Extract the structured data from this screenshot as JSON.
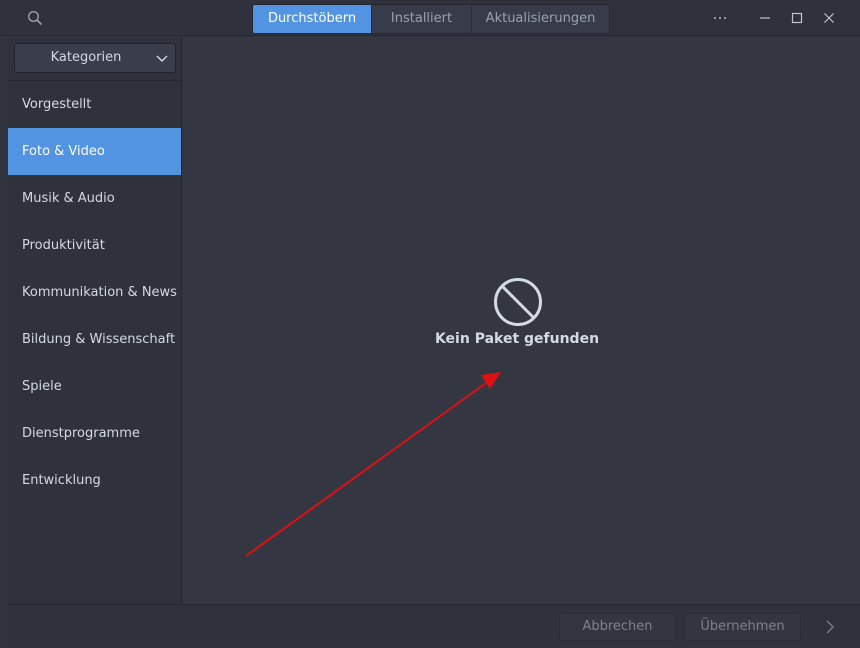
{
  "header": {
    "search_icon": "search-icon",
    "tabs": [
      {
        "label": "Durchstöbern",
        "active": true
      },
      {
        "label": "Installiert",
        "active": false
      },
      {
        "label": "Aktualisierungen",
        "active": false
      }
    ],
    "menu_icon": "more-horizontal-icon",
    "window_controls": [
      "minimize-icon",
      "maximize-icon",
      "close-icon"
    ]
  },
  "sidebar": {
    "category_select": {
      "label": "Kategorien"
    },
    "items": [
      {
        "label": "Vorgestellt",
        "active": false
      },
      {
        "label": "Foto & Video",
        "active": true
      },
      {
        "label": "Musik & Audio",
        "active": false
      },
      {
        "label": "Produktivität",
        "active": false
      },
      {
        "label": "Kommunikation & News",
        "active": false
      },
      {
        "label": "Bildung & Wissenschaft",
        "active": false
      },
      {
        "label": "Spiele",
        "active": false
      },
      {
        "label": "Dienstprogramme",
        "active": false
      },
      {
        "label": "Entwicklung",
        "active": false
      }
    ]
  },
  "main": {
    "empty_state": {
      "icon": "no-entry-icon",
      "text": "Kein Paket gefunden"
    },
    "annotation": {
      "icon": "red-arrow",
      "color": "#dd1111"
    }
  },
  "footer": {
    "cancel_label": "Abbrechen",
    "apply_label": "Übernehmen",
    "next_icon": "chevron-right-icon"
  },
  "colors": {
    "accent": "#5294e2",
    "background": "#343641",
    "panel": "#2f313d"
  }
}
